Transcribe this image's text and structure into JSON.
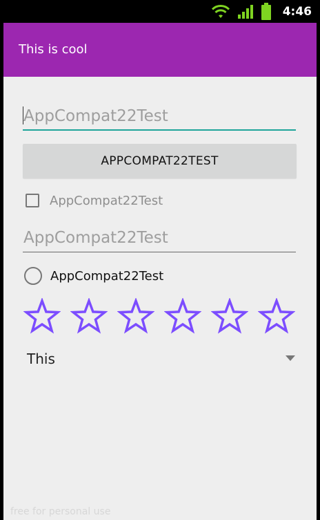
{
  "status_bar": {
    "time": "4:46",
    "icons": [
      "wifi-icon",
      "signal-icon",
      "battery-icon"
    ]
  },
  "app_bar": {
    "title": "This is cool",
    "color": "#9c27b0"
  },
  "edit_text_1": {
    "placeholder": "AppCompat22Test",
    "value": ""
  },
  "button": {
    "label": "APPCOMPAT22TEST"
  },
  "checkbox": {
    "label": "AppCompat22Test",
    "checked": false
  },
  "edit_text_2": {
    "placeholder": "AppCompat22Test",
    "value": ""
  },
  "radio": {
    "label": "AppCompat22Test",
    "checked": false
  },
  "rating_bar": {
    "num_stars": 6,
    "rating": 0,
    "star_color": "#7c4dff"
  },
  "spinner": {
    "selected": "This"
  },
  "watermark": "free for personal use",
  "colors": {
    "accent": "#1ea59a",
    "primary": "#9c27b0",
    "background": "#eeeeee"
  }
}
